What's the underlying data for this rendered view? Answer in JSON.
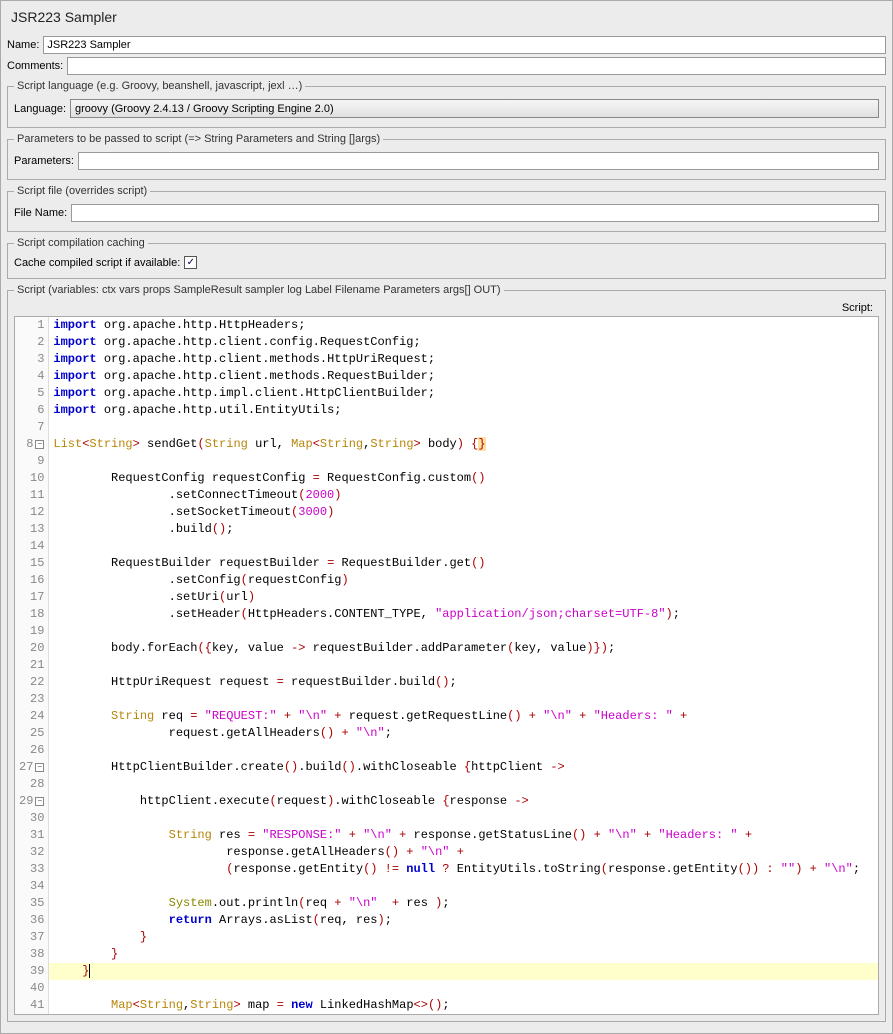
{
  "header": {
    "title": "JSR223 Sampler"
  },
  "fields": {
    "name_label": "Name:",
    "name_value": "JSR223 Sampler",
    "comments_label": "Comments:",
    "comments_value": ""
  },
  "lang_group": {
    "legend": "Script language (e.g. Groovy, beanshell, javascript, jexl …)",
    "label": "Language:",
    "value": "groovy     (Groovy 2.4.13 / Groovy Scripting Engine 2.0)"
  },
  "params_group": {
    "legend": "Parameters to be passed to script (=> String Parameters and String []args)",
    "label": "Parameters:",
    "value": ""
  },
  "file_group": {
    "legend": "Script file (overrides script)",
    "label": "File Name:",
    "value": ""
  },
  "cache_group": {
    "legend": "Script compilation caching",
    "label": "Cache compiled script if available:",
    "checked": true
  },
  "script_group": {
    "legend": "Script (variables: ctx vars props SampleResult sampler log Label Filename Parameters args[] OUT)",
    "label": "Script:"
  },
  "code": {
    "lines": [
      {
        "n": 1,
        "t": "import",
        "rest": " org.apache.http.HttpHeaders;"
      },
      {
        "n": 2,
        "t": "import",
        "rest": " org.apache.http.client.config.RequestConfig;"
      },
      {
        "n": 3,
        "t": "import",
        "rest": " org.apache.http.client.methods.HttpUriRequest;"
      },
      {
        "n": 4,
        "t": "import",
        "rest": " org.apache.http.client.methods.RequestBuilder;"
      },
      {
        "n": 5,
        "t": "import",
        "rest": " org.apache.http.impl.client.HttpClientBuilder;"
      },
      {
        "n": 6,
        "t": "import",
        "rest": " org.apache.http.util.EntityUtils;"
      },
      {
        "n": 7
      },
      {
        "n": 8,
        "fold": true,
        "raw": "<span class='type'>List</span><span class='op'>&lt;</span><span class='type'>String</span><span class='op'>&gt;</span> sendGet<span class='paren'>(</span><span class='type'>String</span> url, <span class='type'>Map</span><span class='op'>&lt;</span><span class='type'>String</span>,<span class='type'>String</span><span class='op'>&gt;</span> body<span class='paren'>)</span> <span class='paren'>{</span><span class='paren' style='background:#ffe0a0'>}</span>"
      },
      {
        "n": 9
      },
      {
        "n": 10,
        "raw": "        RequestConfig requestConfig <span class='op'>=</span> RequestConfig.custom<span class='paren'>()</span>"
      },
      {
        "n": 11,
        "raw": "                .setConnectTimeout<span class='paren'>(</span><span class='num'>2000</span><span class='paren'>)</span>"
      },
      {
        "n": 12,
        "raw": "                .setSocketTimeout<span class='paren'>(</span><span class='num'>3000</span><span class='paren'>)</span>"
      },
      {
        "n": 13,
        "raw": "                .build<span class='paren'>()</span>;"
      },
      {
        "n": 14
      },
      {
        "n": 15,
        "raw": "        RequestBuilder requestBuilder <span class='op'>=</span> RequestBuilder.get<span class='paren'>()</span>"
      },
      {
        "n": 16,
        "raw": "                .setConfig<span class='paren'>(</span>requestConfig<span class='paren'>)</span>"
      },
      {
        "n": 17,
        "raw": "                .setUri<span class='paren'>(</span>url<span class='paren'>)</span>"
      },
      {
        "n": 18,
        "raw": "                .setHeader<span class='paren'>(</span>HttpHeaders.CONTENT_TYPE, <span class='str'>\"application/json;charset=UTF-8\"</span><span class='paren'>)</span>;"
      },
      {
        "n": 19
      },
      {
        "n": 20,
        "raw": "        body.forEach<span class='paren'>(</span><span class='paren'>{</span>key, value <span class='op'>-&gt;</span> requestBuilder.addParameter<span class='paren'>(</span>key, value<span class='paren'>)</span><span class='paren'>}</span><span class='paren'>)</span>;"
      },
      {
        "n": 21
      },
      {
        "n": 22,
        "raw": "        HttpUriRequest request <span class='op'>=</span> requestBuilder.build<span class='paren'>()</span>;"
      },
      {
        "n": 23
      },
      {
        "n": 24,
        "raw": "        <span class='type'>String</span> req <span class='op'>=</span> <span class='str'>\"REQUEST:\"</span> <span class='op'>+</span> <span class='str'>\"\\n\"</span> <span class='op'>+</span> request.getRequestLine<span class='paren'>()</span> <span class='op'>+</span> <span class='str'>\"\\n\"</span> <span class='op'>+</span> <span class='str'>\"Headers: \"</span> <span class='op'>+</span>"
      },
      {
        "n": 25,
        "raw": "                request.getAllHeaders<span class='paren'>()</span> <span class='op'>+</span> <span class='str'>\"\\n\"</span>;"
      },
      {
        "n": 26
      },
      {
        "n": 27,
        "fold": true,
        "raw": "        HttpClientBuilder.create<span class='paren'>()</span>.build<span class='paren'>()</span>.withCloseable <span class='paren'>{</span>httpClient <span class='op'>-&gt;</span>"
      },
      {
        "n": 28
      },
      {
        "n": 29,
        "fold": true,
        "raw": "            httpClient.execute<span class='paren'>(</span>request<span class='paren'>)</span>.withCloseable <span class='paren'>{</span>response <span class='op'>-&gt;</span>"
      },
      {
        "n": 30
      },
      {
        "n": 31,
        "raw": "                <span class='type'>String</span> res <span class='op'>=</span> <span class='str'>\"RESPONSE:\"</span> <span class='op'>+</span> <span class='str'>\"\\n\"</span> <span class='op'>+</span> response.getStatusLine<span class='paren'>()</span> <span class='op'>+</span> <span class='str'>\"\\n\"</span> <span class='op'>+</span> <span class='str'>\"Headers: \"</span> <span class='op'>+</span>"
      },
      {
        "n": 32,
        "raw": "                        response.getAllHeaders<span class='paren'>()</span> <span class='op'>+</span> <span class='str'>\"\\n\"</span> <span class='op'>+</span>"
      },
      {
        "n": 33,
        "raw": "                        <span class='paren'>(</span>response.getEntity<span class='paren'>()</span> <span class='op'>!=</span> <span class='kw'>null</span> <span class='op'>?</span> EntityUtils.toString<span class='paren'>(</span>response.getEntity<span class='paren'>()</span><span class='paren'>)</span> <span class='op'>:</span> <span class='str'>\"\"</span><span class='paren'>)</span> <span class='op'>+</span> <span class='str'>\"\\n\"</span>;"
      },
      {
        "n": 34
      },
      {
        "n": 35,
        "raw": "                <span class='type2'>System</span>.out.println<span class='paren'>(</span>req <span class='op'>+</span> <span class='str'>\"\\n\"</span>  <span class='op'>+</span> res <span class='paren'>)</span>;"
      },
      {
        "n": 36,
        "raw": "                <span class='kw'>return</span> Arrays.asList<span class='paren'>(</span>req, res<span class='paren'>)</span>;"
      },
      {
        "n": 37,
        "raw": "            <span class='paren'>}</span>"
      },
      {
        "n": 38,
        "raw": "        <span class='paren'>}</span>"
      },
      {
        "n": 39,
        "hl": true,
        "raw": "    <span class='paren'>}</span><span class='cursor'></span>"
      },
      {
        "n": 40
      },
      {
        "n": 41,
        "raw": "        <span class='type'>Map</span><span class='op'>&lt;</span><span class='type'>String</span>,<span class='type'>String</span><span class='op'>&gt;</span> map <span class='op'>=</span> <span class='kw'>new</span> LinkedHashMap<span class='op'>&lt;&gt;</span><span class='paren'>()</span>;"
      }
    ]
  }
}
